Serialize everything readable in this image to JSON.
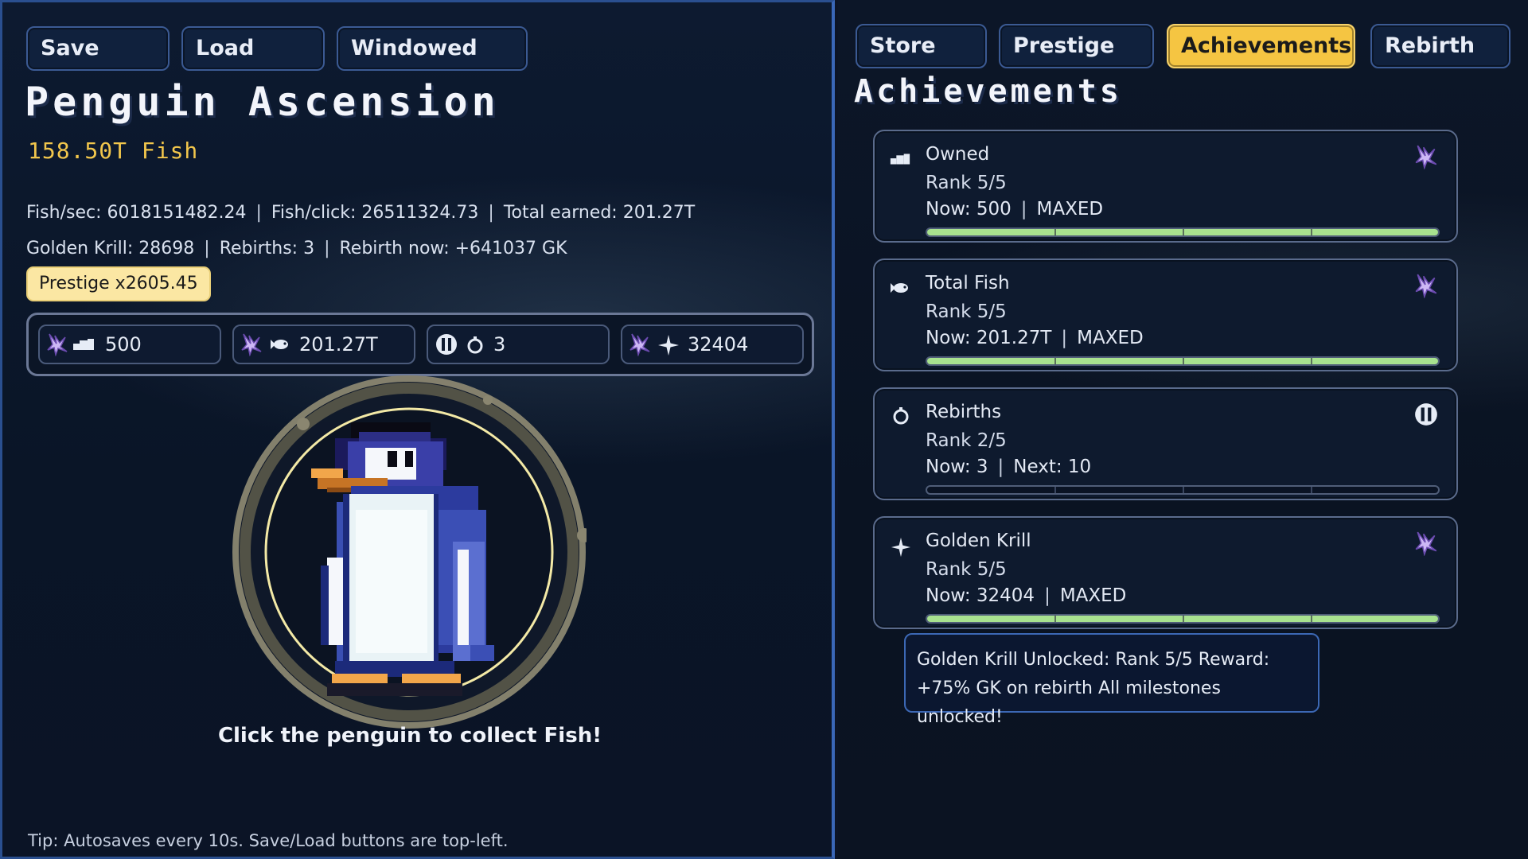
{
  "game": {
    "title": "Penguin Ascension"
  },
  "left_buttons": [
    {
      "label": "Save"
    },
    {
      "label": "Load"
    },
    {
      "label": "Windowed"
    }
  ],
  "tabs": [
    {
      "label": "Store"
    },
    {
      "label": "Prestige"
    },
    {
      "label": "Achievements",
      "active": true
    },
    {
      "label": "Rebirth"
    }
  ],
  "currency": {
    "fish": "158.50T Fish"
  },
  "stats": {
    "fish_sec": "Fish/sec: 6018151482.24",
    "fish_click": "Fish/click: 26511324.73",
    "total_earned": "Total earned: 201.27T",
    "golden_krill": "Golden Krill: 28698",
    "rebirths": "Rebirths: 3",
    "rebirth_now": "Rebirth now: +641037 GK",
    "separator": "|"
  },
  "prestige_badge": "Prestige x2605.45",
  "chips": [
    {
      "value": "500",
      "state_icon": "star-badge-icon",
      "kind_icon": "igloo-icon"
    },
    {
      "value": "201.27T",
      "state_icon": "star-badge-icon",
      "kind_icon": "fish-icon"
    },
    {
      "value": "3",
      "state_icon": "lock-icon",
      "kind_icon": "ring-icon"
    },
    {
      "value": "32404",
      "state_icon": "star-badge-icon",
      "kind_icon": "sparkle-icon"
    }
  ],
  "click_hint": "Click the penguin to collect Fish!",
  "tip": "Tip: Autosaves every 10s. Save/Load buttons are top-left.",
  "achievements": {
    "title": "Achievements",
    "items": [
      {
        "name": "Owned",
        "rank": "Rank 5/5",
        "now": "Now: 500",
        "status": "MAXED",
        "progress": 1.0,
        "kind_icon": "igloo-icon",
        "state_icon": "star-badge-icon"
      },
      {
        "name": "Total Fish",
        "rank": "Rank 5/5",
        "now": "Now: 201.27T",
        "status": "MAXED",
        "progress": 1.0,
        "kind_icon": "fish-icon",
        "state_icon": "star-badge-icon"
      },
      {
        "name": "Rebirths",
        "rank": "Rank 2/5",
        "now": "Now: 3",
        "status": "Next: 10",
        "progress": 0.0,
        "kind_icon": "ring-icon",
        "state_icon": "lock-icon"
      },
      {
        "name": "Golden Krill",
        "rank": "Rank 5/5",
        "now": "Now: 32404",
        "status": "MAXED",
        "progress": 1.0,
        "kind_icon": "sparkle-icon",
        "state_icon": "star-badge-icon"
      }
    ]
  },
  "tooltip": {
    "line1": "Golden Krill Unlocked: Rank 5/5 Reward:",
    "line2": "+75% GK on rebirth All milestones unlocked!"
  },
  "colors": {
    "accent": "#f5c542",
    "progress": "#a8e28f",
    "panel_border": "#3b5a93"
  }
}
